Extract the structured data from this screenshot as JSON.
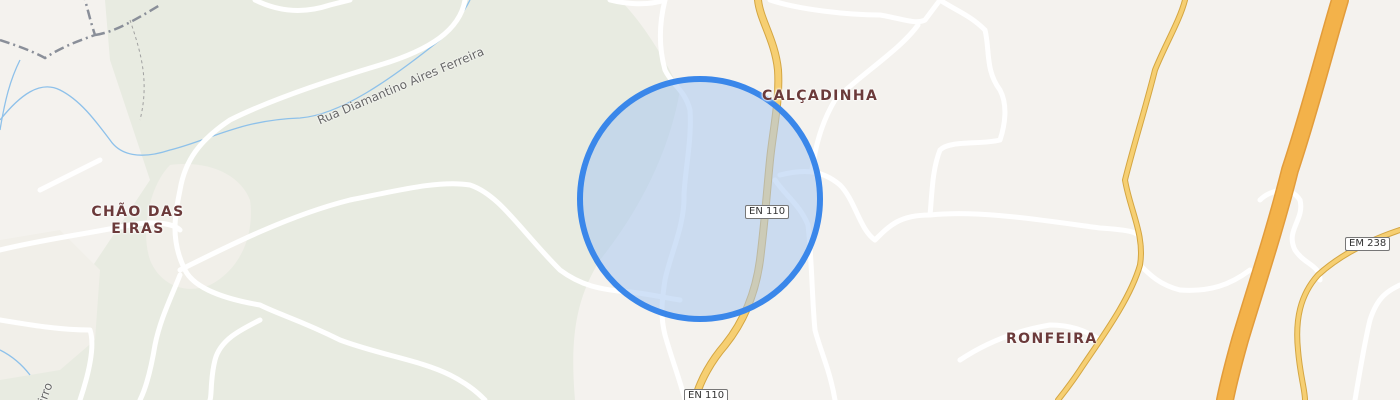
{
  "places": {
    "calcadinha": "CALÇADINHA",
    "chao_das_eiras": "CHÃO DAS\nEIRAS",
    "ronfeira": "RONFEIRA"
  },
  "roads": {
    "en110_upper": "EN 110",
    "en110_lower": "EN 110",
    "em238": "EM 238",
    "rua_diamantino": "Rua Diamantino Aires Ferreira",
    "rua_partial": "irro"
  },
  "colors": {
    "land": "#f4f2ee",
    "forest": "#e8ebe1",
    "road_major": "#f4c96b",
    "road_minor": "#ffffff",
    "water": "#8ec1ea",
    "marker_fill": "#a9c8f0",
    "marker_stroke": "#3a87ea"
  }
}
